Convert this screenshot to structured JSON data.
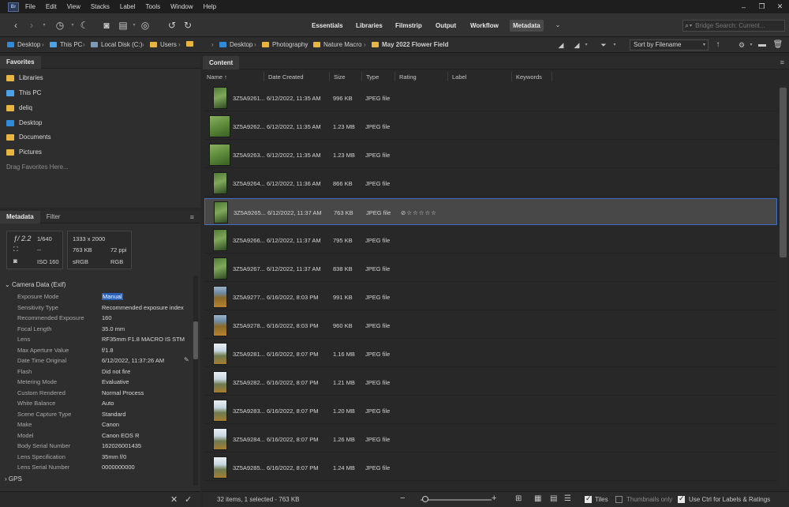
{
  "app": {
    "logo": "Br",
    "menu": [
      "File",
      "Edit",
      "View",
      "Stacks",
      "Label",
      "Tools",
      "Window",
      "Help"
    ]
  },
  "window_controls": [
    "–",
    "❐",
    "✕"
  ],
  "toolbar": {
    "workspaces": [
      "Essentials",
      "Libraries",
      "Filmstrip",
      "Output",
      "Workflow",
      "Metadata"
    ],
    "active_workspace": "Metadata",
    "search_placeholder": "Bridge Search: Current..."
  },
  "path": {
    "left": [
      "Desktop",
      "This PC",
      "Local Disk (C:)",
      "Users"
    ],
    "right": [
      "Desktop",
      "Photography",
      "Nature Macro",
      "May 2022 Flower Field"
    ],
    "sort_label": "Sort by Filename"
  },
  "favorites": {
    "title": "Favorites",
    "items": [
      "Libraries",
      "This PC",
      "deliq",
      "Desktop",
      "Documents",
      "Pictures"
    ],
    "hint": "Drag Favorites Here..."
  },
  "metadata": {
    "tabs": [
      "Metadata",
      "Filter"
    ],
    "box1": {
      "aperture": "ƒ/ 2.2",
      "shutter": "1/640",
      "metering": "--",
      "iso": "ISO 160"
    },
    "box2": {
      "dimensions": "1333 x 2000",
      "size": "763 KB",
      "ppi": "72 ppi",
      "colorspace": "sRGB",
      "mode": "RGB"
    },
    "section": "Camera Data (Exif)",
    "rows": [
      {
        "label": "Exposure Mode",
        "value": "Manual"
      },
      {
        "label": "Sensitivity Type",
        "value": "Recommended exposure index"
      },
      {
        "label": "Recommended Exposure",
        "value": "160"
      },
      {
        "label": "Focal Length",
        "value": "35.0 mm"
      },
      {
        "label": "Lens",
        "value": "RF35mm F1.8 MACRO IS STM"
      },
      {
        "label": "Max Aperture Value",
        "value": "f/1.8"
      },
      {
        "label": "Date Time Original",
        "value": "6/12/2022, 11:37:26 AM"
      },
      {
        "label": "Flash",
        "value": "Did not fire"
      },
      {
        "label": "Metering Mode",
        "value": "Evaluative"
      },
      {
        "label": "Custom Rendered",
        "value": "Normal Process"
      },
      {
        "label": "White Balance",
        "value": "Auto"
      },
      {
        "label": "Scene Capture Type",
        "value": "Standard"
      },
      {
        "label": "Make",
        "value": "Canon"
      },
      {
        "label": "Model",
        "value": "Canon EOS R"
      },
      {
        "label": "Body Serial Number",
        "value": "162026001435"
      },
      {
        "label": "Lens Specification",
        "value": "35mm f/0"
      },
      {
        "label": "Lens Serial Number",
        "value": "0000000000"
      }
    ],
    "gps_section": "GPS"
  },
  "content": {
    "title": "Content",
    "columns": [
      "Name",
      "Date Created",
      "Size",
      "Type",
      "Rating",
      "Label",
      "Keywords"
    ],
    "files": [
      {
        "name": "3Z5A9261...",
        "date": "6/12/2022, 11:35 AM",
        "size": "996 KB",
        "type": "JPEG file",
        "thumb": "portrait-green",
        "rating": ""
      },
      {
        "name": "3Z5A9262...",
        "date": "6/12/2022, 11:35 AM",
        "size": "1.23 MB",
        "type": "JPEG file",
        "thumb": "landscape-green",
        "rating": ""
      },
      {
        "name": "3Z5A9263...",
        "date": "6/12/2022, 11:35 AM",
        "size": "1.23 MB",
        "type": "JPEG file",
        "thumb": "landscape-green",
        "rating": ""
      },
      {
        "name": "3Z5A9264...",
        "date": "6/12/2022, 11:36 AM",
        "size": "866 KB",
        "type": "JPEG file",
        "thumb": "portrait-green",
        "rating": ""
      },
      {
        "name": "3Z5A9265...",
        "date": "6/12/2022, 11:37 AM",
        "size": "763 KB",
        "type": "JPEG file",
        "thumb": "portrait-green",
        "rating": "⊘☆☆☆☆☆"
      },
      {
        "name": "3Z5A9266...",
        "date": "6/12/2022, 11:37 AM",
        "size": "795 KB",
        "type": "JPEG file",
        "thumb": "portrait-green",
        "rating": ""
      },
      {
        "name": "3Z5A9267...",
        "date": "6/12/2022, 11:37 AM",
        "size": "838 KB",
        "type": "JPEG file",
        "thumb": "portrait-green",
        "rating": ""
      },
      {
        "name": "3Z5A9277...",
        "date": "6/16/2022, 8:03 PM",
        "size": "991 KB",
        "type": "JPEG file",
        "thumb": "portrait-field",
        "rating": ""
      },
      {
        "name": "3Z5A9278...",
        "date": "6/16/2022, 8:03 PM",
        "size": "960 KB",
        "type": "JPEG file",
        "thumb": "portrait-field",
        "rating": ""
      },
      {
        "name": "3Z5A9281...",
        "date": "6/16/2022, 8:07 PM",
        "size": "1.16 MB",
        "type": "JPEG file",
        "thumb": "portrait-sky",
        "rating": ""
      },
      {
        "name": "3Z5A9282...",
        "date": "6/16/2022, 8:07 PM",
        "size": "1.21 MB",
        "type": "JPEG file",
        "thumb": "portrait-sky",
        "rating": ""
      },
      {
        "name": "3Z5A9283...",
        "date": "6/16/2022, 8:07 PM",
        "size": "1.20 MB",
        "type": "JPEG file",
        "thumb": "portrait-sky",
        "rating": ""
      },
      {
        "name": "3Z5A9284...",
        "date": "6/16/2022, 8:07 PM",
        "size": "1.26 MB",
        "type": "JPEG file",
        "thumb": "portrait-sky",
        "rating": ""
      },
      {
        "name": "3Z5A9285...",
        "date": "6/16/2022, 8:07 PM",
        "size": "1.24 MB",
        "type": "JPEG file",
        "thumb": "portrait-sky",
        "rating": ""
      }
    ],
    "selected_index": 4
  },
  "status": {
    "summary": "32 items, 1 selected - 763 KB",
    "tiles": "Tiles",
    "thumbnails_only": "Thumbnails only",
    "ctrl_labels": "Use Ctrl for Labels & Ratings"
  },
  "colors": {
    "selection_blue": "#2a5fb4",
    "folder_yellow": "#e8b640"
  }
}
